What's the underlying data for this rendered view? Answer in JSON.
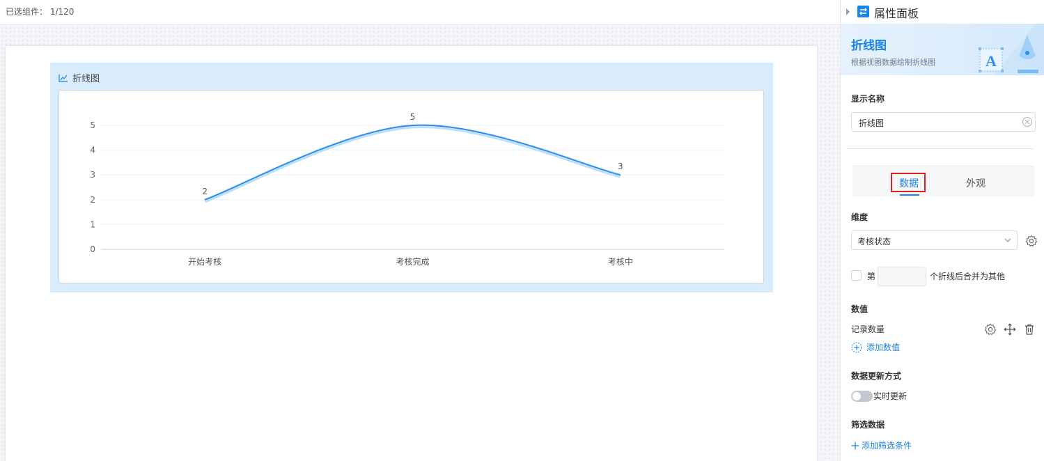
{
  "topbar": {
    "selected_label": "已选组件：",
    "selected_value": "1/120"
  },
  "widget": {
    "title": "折线图"
  },
  "chart_data": {
    "type": "line",
    "categories": [
      "开始考核",
      "考核完成",
      "考核中"
    ],
    "values": [
      2,
      5,
      3
    ],
    "data_labels": [
      "2",
      "5",
      "3"
    ],
    "y_ticks": [
      "0",
      "1",
      "2",
      "3",
      "4",
      "5"
    ],
    "ylim": [
      0,
      5
    ],
    "grid": true,
    "smooth": true,
    "line_color": "#2b8ef0"
  },
  "panel": {
    "title": "属性面板",
    "banner_title": "折线图",
    "banner_subtitle": "根据视图数据绘制折线图",
    "display_name_label": "显示名称",
    "display_name_value": "折线图",
    "tabs": [
      {
        "label": "数据",
        "active": true
      },
      {
        "label": "外观",
        "active": false
      }
    ],
    "dimension_label": "维度",
    "dimension_value": "考核状态",
    "merge_prefix": "第",
    "merge_value": "",
    "merge_suffix": "个折线后合并为其他",
    "values_label": "数值",
    "value_item": "记录数量",
    "add_value": "添加数值",
    "update_label": "数据更新方式",
    "update_toggle_label": "实时更新",
    "update_toggle_on": false,
    "filter_label": "筛选数据",
    "add_filter": "添加筛选条件",
    "accent_color": "#1a84e7"
  }
}
